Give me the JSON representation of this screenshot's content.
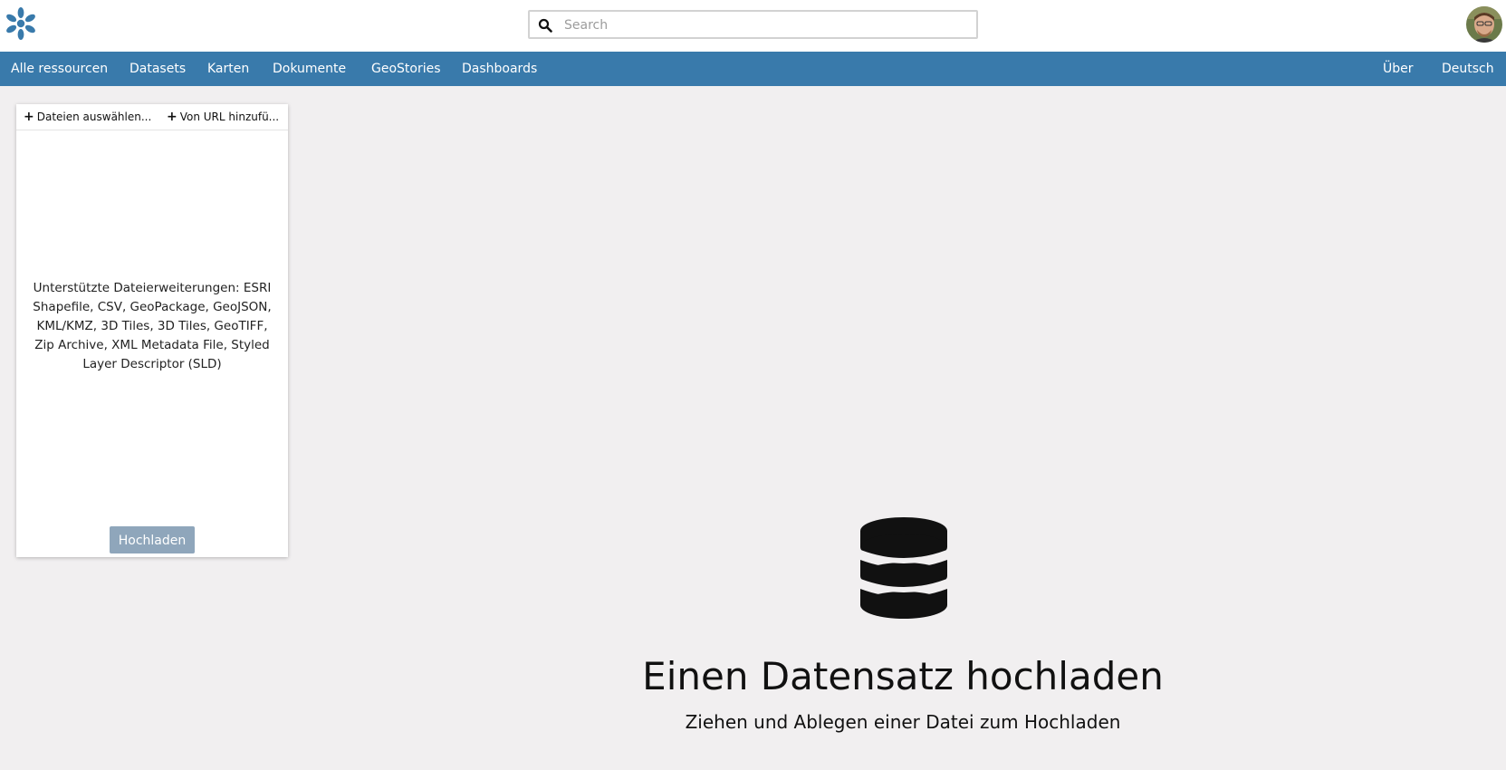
{
  "header": {
    "logo_icon": "geonode-logo-icon",
    "search": {
      "placeholder": "Search",
      "value": ""
    },
    "avatar_icon": "user-avatar-icon"
  },
  "nav": {
    "left": [
      {
        "label": "Alle ressourcen"
      },
      {
        "label": "Datasets"
      },
      {
        "label": "Karten"
      },
      {
        "label": "Dokumente"
      },
      {
        "label": "GeoStories"
      },
      {
        "label": "Dashboards"
      }
    ],
    "right": [
      {
        "label": "Über"
      },
      {
        "label": "Deutsch"
      }
    ]
  },
  "upload_panel": {
    "select_files_label": "Dateien auswählen...",
    "from_url_label": "Von URL hinzufü...",
    "supported_text": "Unterstützte Dateierweiterungen: ESRI Shapefile, CSV, GeoPackage, GeoJSON, KML/KMZ, 3D Tiles, 3D Tiles, GeoTIFF, Zip Archive, XML Metadata File, Styled Layer Descriptor (SLD)",
    "upload_button_label": "Hochladen"
  },
  "dropzone": {
    "icon": "database-icon",
    "title": "Einen Datensatz hochladen",
    "subtitle": "Ziehen und Ablegen einer Datei zum Hochladen"
  },
  "colors": {
    "navbar": "#397aab",
    "background": "#f1eff0",
    "upload_button": "#8fa6bb",
    "logo": "#397aab"
  }
}
